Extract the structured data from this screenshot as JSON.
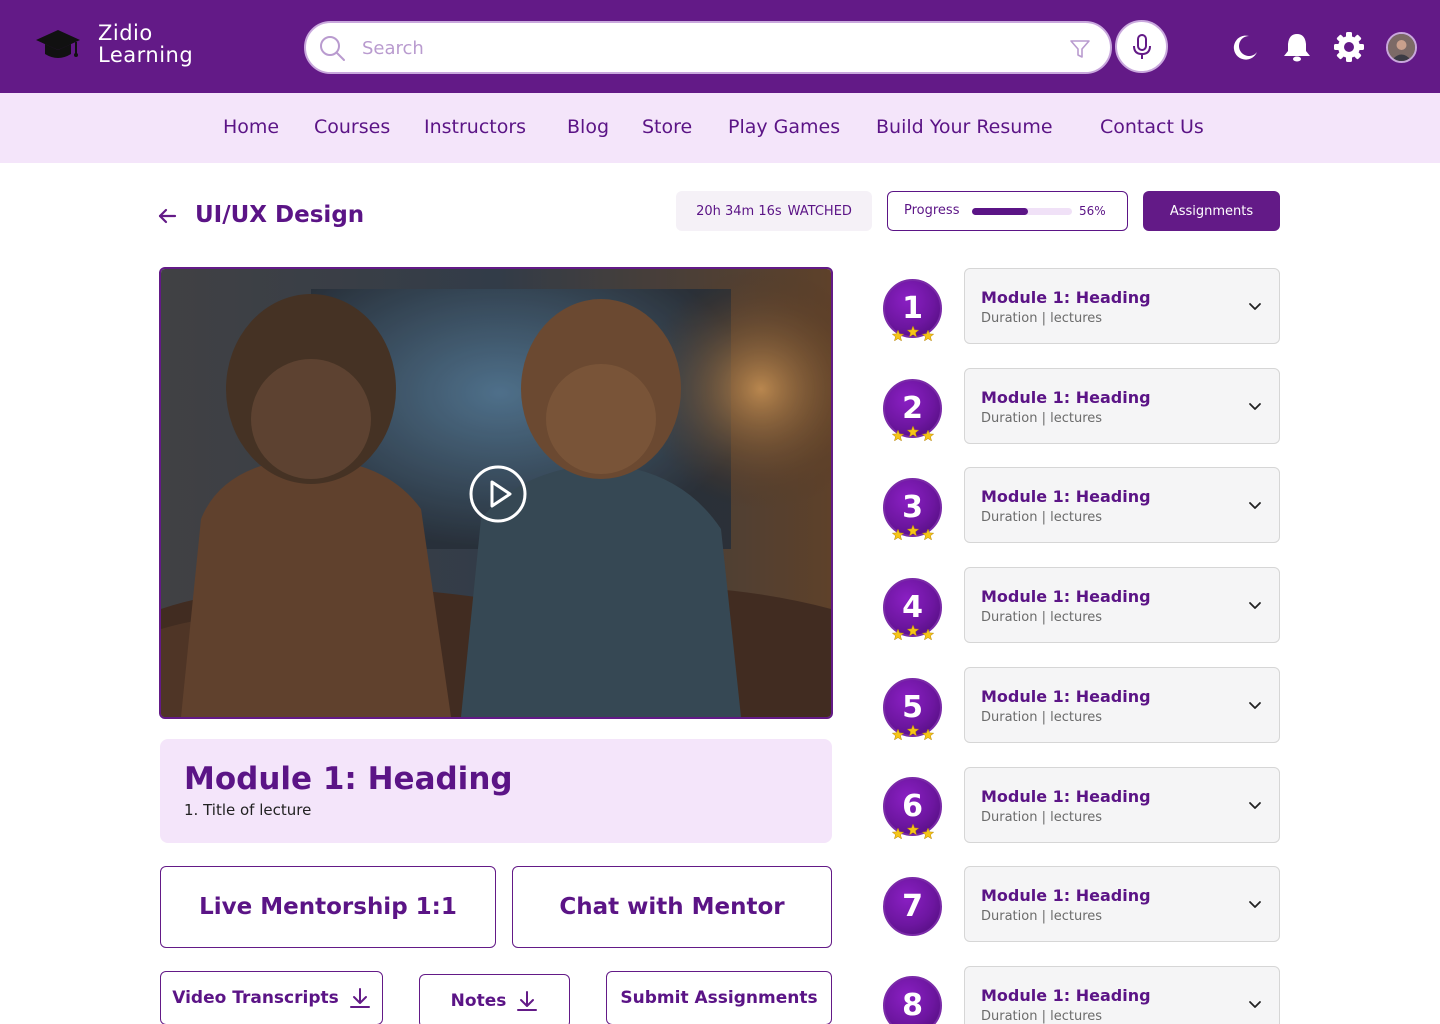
{
  "brand": {
    "line1": "Zidio",
    "line2": "Learning"
  },
  "search": {
    "placeholder": "Search"
  },
  "nav": [
    "Home",
    "Courses",
    "Instructors",
    "Blog",
    "Store",
    "Play Games",
    "Build Your Resume",
    "Contact Us"
  ],
  "course": {
    "title": "UI/UX Design",
    "watched_time": "20h 34m 16s",
    "watched_label": "WATCHED",
    "progress_label": "Progress",
    "progress_percent": 56,
    "progress_text": "56%",
    "assignments_label": "Assignments"
  },
  "current_module": {
    "title": "Module 1: Heading",
    "lecture": "1. Title of lecture"
  },
  "actions": {
    "live_mentorship": "Live Mentorship 1:1",
    "chat_mentor": "Chat with Mentor",
    "video_transcripts": "Video Transcripts",
    "notes": "Notes",
    "submit_assignments": "Submit Assignments"
  },
  "modules": [
    {
      "number": "1",
      "title": "Module 1: Heading",
      "meta": "Duration | lectures",
      "stars": 3
    },
    {
      "number": "2",
      "title": "Module 1: Heading",
      "meta": "Duration | lectures",
      "stars": 3
    },
    {
      "number": "3",
      "title": "Module 1: Heading",
      "meta": "Duration | lectures",
      "stars": 3
    },
    {
      "number": "4",
      "title": "Module 1: Heading",
      "meta": "Duration | lectures",
      "stars": 3
    },
    {
      "number": "5",
      "title": "Module 1: Heading",
      "meta": "Duration | lectures",
      "stars": 3
    },
    {
      "number": "6",
      "title": "Module 1: Heading",
      "meta": "Duration | lectures",
      "stars": 3
    },
    {
      "number": "7",
      "title": "Module 1: Heading",
      "meta": "Duration | lectures",
      "stars": 0
    },
    {
      "number": "8",
      "title": "Module 1: Heading",
      "meta": "Duration | lectures",
      "stars": 0
    }
  ],
  "icons": {
    "logo": "graduation-cap-icon",
    "search": "search-icon",
    "filter": "filter-icon",
    "mic": "microphone-icon",
    "theme": "moon-icon",
    "notifications": "bell-icon",
    "settings": "gear-icon",
    "play": "play-icon",
    "download": "download-icon",
    "expand": "chevron-down-icon"
  },
  "colors": {
    "primary": "#631a87",
    "nav_bg": "#f4e5fa",
    "star": "#f5c518"
  }
}
